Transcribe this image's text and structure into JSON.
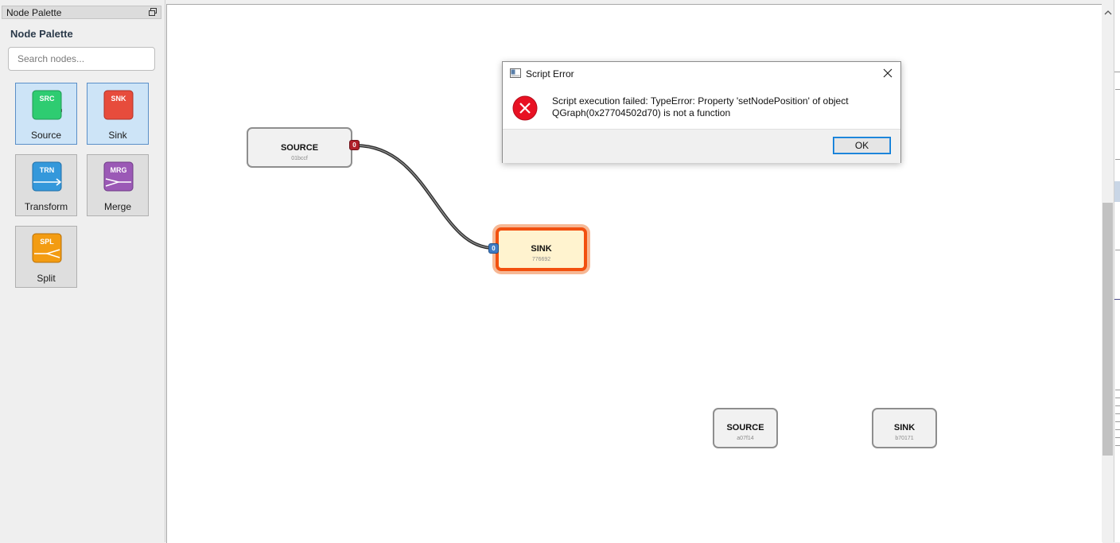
{
  "palette": {
    "dock_title": "Node Palette",
    "heading": "Node Palette",
    "search_placeholder": "Search nodes...",
    "items": [
      {
        "label": "Source",
        "badge": "SRC",
        "color": "#2ecc71",
        "selected": true
      },
      {
        "label": "Sink",
        "badge": "SNK",
        "color": "#e74c3c",
        "selected": true
      },
      {
        "label": "Transform",
        "badge": "TRN",
        "color": "#3498db",
        "selected": false
      },
      {
        "label": "Merge",
        "badge": "MRG",
        "color": "#9b59b6",
        "selected": false
      },
      {
        "label": "Split",
        "badge": "SPL",
        "color": "#f39c12",
        "selected": false
      }
    ]
  },
  "graph": {
    "nodes": [
      {
        "title": "SOURCE",
        "id": "01bccf",
        "selected": false
      },
      {
        "title": "SINK",
        "id": "776692",
        "selected": true
      },
      {
        "title": "SOURCE",
        "id": "a07f14",
        "selected": false
      },
      {
        "title": "SINK",
        "id": "b70171",
        "selected": false
      }
    ],
    "ports": {
      "out_label": "0",
      "in_label": "0"
    },
    "colors": {
      "output_port": "#b01f2a",
      "input_port": "#3e7bc4",
      "selection": "#f2500f",
      "edge": "#444444"
    }
  },
  "dialog": {
    "title": "Script Error",
    "message_line1": "Script execution failed: TypeError: Property 'setNodePosition' of object",
    "message_line2": "QGraph(0x27704502d70) is not a function",
    "ok_label": "OK",
    "icon": "error-icon"
  }
}
